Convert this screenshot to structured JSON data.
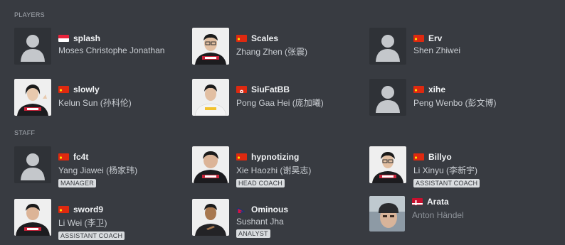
{
  "sections": {
    "players": "PLAYERS",
    "staff": "STAFF"
  },
  "colors": {
    "background": "#383b41",
    "placeholder_bg": "#2f3237",
    "placeholder_fg": "#c4c7cb",
    "role_bg": "#d9dcdf"
  },
  "players": [
    {
      "nick": "splash",
      "name": "Moses Christophe Jonathan",
      "flag": "indonesia-flag",
      "avatar": "placeholder"
    },
    {
      "nick": "Scales",
      "name": "Zhang Zhen (张震)",
      "flag": "china-flag",
      "avatar": "player-photo"
    },
    {
      "nick": "Erv",
      "name": "Shen Zhiwei",
      "flag": "china-flag",
      "avatar": "placeholder"
    },
    {
      "nick": "slowly",
      "name": "Kelun Sun (孙科伦)",
      "flag": "china-flag",
      "avatar": "player-photo"
    },
    {
      "nick": "SiuFatBB",
      "name": "Pong Gaa Hei (庞加曦)",
      "flag": "hong-kong-flag",
      "avatar": "player-photo-white"
    },
    {
      "nick": "xihe",
      "name": "Peng Wenbo (彭文博)",
      "flag": "china-flag",
      "avatar": "placeholder"
    }
  ],
  "staff": [
    {
      "nick": "fc4t",
      "name": "Yang Jiawei (杨家玮)",
      "role": "MANAGER",
      "flag": "china-flag",
      "avatar": "placeholder"
    },
    {
      "nick": "hypnotizing",
      "name": "Xie Haozhi (谢昊志)",
      "role": "HEAD COACH",
      "flag": "china-flag",
      "avatar": "player-photo"
    },
    {
      "nick": "Billyo",
      "name": "Li Xinyu (李新宇)",
      "role": "ASSISTANT COACH",
      "flag": "china-flag",
      "avatar": "player-photo"
    },
    {
      "nick": "sword9",
      "name": "Li Wei (李卫)",
      "role": "ASSISTANT COACH",
      "flag": "china-flag",
      "avatar": "player-photo"
    },
    {
      "nick": "Ominous",
      "name": "Sushant Jha",
      "role": "ANALYST",
      "flag": "nepal-flag",
      "avatar": "player-photo-dark"
    },
    {
      "nick": "Arata",
      "name": "Anton Händel",
      "role": "",
      "flag": "denmark-flag",
      "avatar": "casual-photo"
    }
  ]
}
